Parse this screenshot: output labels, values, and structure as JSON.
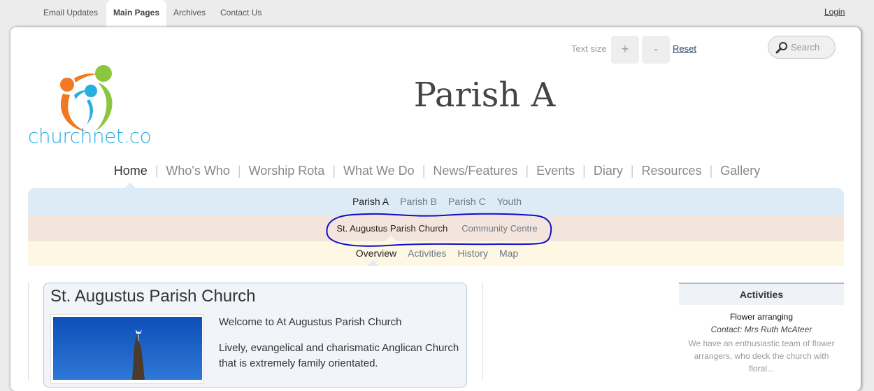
{
  "topbar": {
    "tabs": [
      {
        "label": "Email Updates",
        "active": false
      },
      {
        "label": "Main Pages",
        "active": true
      },
      {
        "label": "Archives",
        "active": false
      },
      {
        "label": "Contact Us",
        "active": false
      }
    ],
    "login": "Login"
  },
  "tools": {
    "text_size_label": "Text size",
    "increase": "+",
    "decrease": "-",
    "reset": "Reset",
    "search_placeholder": "Search"
  },
  "brand": {
    "logo_text": "churchnet.co",
    "colors": {
      "orange": "#f07a22",
      "green": "#8cc63f",
      "blue": "#29aee0"
    }
  },
  "site_title": "Parish A",
  "main_nav": [
    {
      "label": "Home",
      "active": true
    },
    {
      "label": "Who's Who",
      "active": false
    },
    {
      "label": "Worship Rota",
      "active": false
    },
    {
      "label": "What We Do",
      "active": false
    },
    {
      "label": "News/Features",
      "active": false
    },
    {
      "label": "Events",
      "active": false
    },
    {
      "label": "Diary",
      "active": false
    },
    {
      "label": "Resources",
      "active": false
    },
    {
      "label": "Gallery",
      "active": false
    }
  ],
  "parish_nav": [
    {
      "label": "Parish A",
      "active": true
    },
    {
      "label": "Parish B",
      "active": false
    },
    {
      "label": "Parish C",
      "active": false
    },
    {
      "label": "Youth",
      "active": false
    }
  ],
  "venue_nav": [
    {
      "label": "St. Augustus Parish Church",
      "active": true
    },
    {
      "label": "Community Centre",
      "active": false
    }
  ],
  "page_nav": [
    {
      "label": "Overview",
      "active": true
    },
    {
      "label": "Activities",
      "active": false
    },
    {
      "label": "History",
      "active": false
    },
    {
      "label": "Map",
      "active": false
    }
  ],
  "content": {
    "title": "St. Augustus Parish Church",
    "paragraphs": [
      "Welcome to At Augustus Parish Church",
      "Lively, evangelical and charismatic Anglican Church",
      "that is extremely family orientated."
    ]
  },
  "sidebar": {
    "heading": "Activities",
    "items": [
      {
        "title": "Flower arranging",
        "contact": "Contact: Mrs Ruth McAteer",
        "description": "We have an enthusiastic team of flower arrangers, who deck the church with floral..."
      }
    ]
  }
}
